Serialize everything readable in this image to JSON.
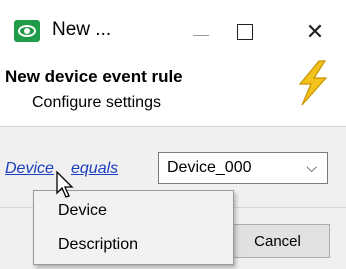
{
  "window": {
    "title": "New ...",
    "minimize_icon": "minimize-icon",
    "maximize_icon": "maximize-icon",
    "close_glyph": "✕",
    "app_icon": "eye-icon",
    "app_icon_color": "#1f9b4a"
  },
  "header": {
    "title": "New device event rule",
    "subtitle": "Configure settings",
    "icon": "lightning-bolt-icon",
    "icon_color": "#f3c21c"
  },
  "rule": {
    "field_link": "Device",
    "operator_link": "equals",
    "link_color": "#1a3fbf",
    "value_select": {
      "selected": "Device_000",
      "arrow_glyph": "⌵"
    }
  },
  "footer": {
    "cancel_label": "Cancel"
  },
  "popup_menu": {
    "items": [
      "Device",
      "Description"
    ]
  },
  "cursor": "arrow-cursor-icon"
}
